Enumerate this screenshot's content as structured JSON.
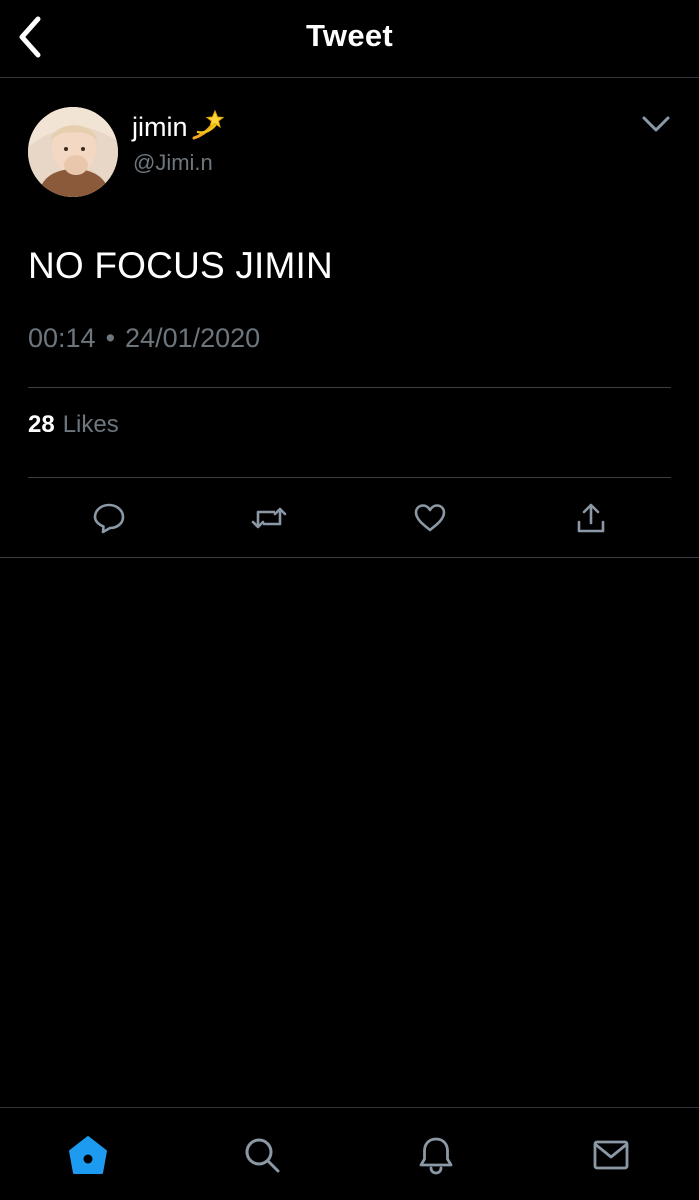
{
  "header": {
    "title": "Tweet",
    "back_icon": "chevron-left-icon"
  },
  "tweet": {
    "author": {
      "display_name": "jimin",
      "emoji": "💫",
      "handle": "@Jimi.n"
    },
    "text": "NO FOCUS JIMIN",
    "time": "00:14",
    "separator": "•",
    "date": "24/01/2020",
    "likes_count": "28",
    "likes_label": "Likes"
  },
  "actions": [
    "reply-icon",
    "retweet-icon",
    "like-icon",
    "share-icon"
  ],
  "tabbar": {
    "items": [
      "home-icon",
      "search-icon",
      "notifications-icon",
      "messages-icon"
    ],
    "active": "home-icon",
    "active_color": "#1d9bf0"
  },
  "colors": {
    "background": "#000000",
    "secondary_text": "#6e767d",
    "divider": "#3a3f44",
    "icon": "#8b98a5"
  }
}
